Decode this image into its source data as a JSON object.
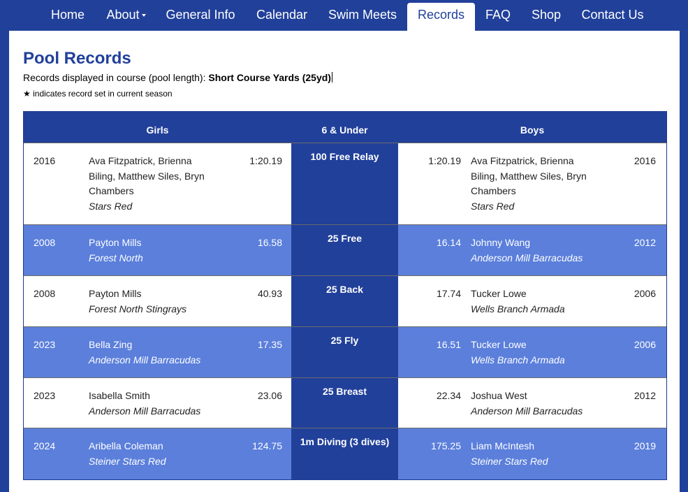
{
  "nav": {
    "items": [
      {
        "label": "Home"
      },
      {
        "label": "About"
      },
      {
        "label": "General Info"
      },
      {
        "label": "Calendar"
      },
      {
        "label": "Swim Meets"
      },
      {
        "label": "Records"
      },
      {
        "label": "FAQ"
      },
      {
        "label": "Shop"
      },
      {
        "label": "Contact Us"
      }
    ],
    "active": "Records"
  },
  "page": {
    "title": "Pool Records",
    "course_prefix": "Records displayed in course (pool length):",
    "course_value": "Short Course Yards (25yd)",
    "star_symbol": "★",
    "star_note": "indicates record set in current season"
  },
  "table": {
    "headers": {
      "girls": "Girls",
      "age_group": "6 & Under",
      "boys": "Boys"
    },
    "rows": [
      {
        "event": "100 Free Relay",
        "girls": {
          "year": "2016",
          "name": "Ava Fitzpatrick, Brienna Biling, Matthew Siles, Bryn Chambers",
          "team": "Stars Red",
          "time": "1:20.19"
        },
        "boys": {
          "year": "2016",
          "name": "Ava Fitzpatrick, Brienna Biling, Matthew Siles, Bryn Chambers",
          "team": "Stars Red",
          "time": "1:20.19"
        }
      },
      {
        "event": "25 Free",
        "girls": {
          "year": "2008",
          "name": "Payton Mills",
          "team": "Forest North",
          "time": "16.58"
        },
        "boys": {
          "year": "2012",
          "name": "Johnny Wang",
          "team": "Anderson Mill Barracudas",
          "time": "16.14"
        }
      },
      {
        "event": "25 Back",
        "girls": {
          "year": "2008",
          "name": "Payton Mills",
          "team": "Forest North Stingrays",
          "time": "40.93"
        },
        "boys": {
          "year": "2006",
          "name": "Tucker Lowe",
          "team": "Wells Branch Armada",
          "time": "17.74"
        }
      },
      {
        "event": "25 Fly",
        "girls": {
          "year": "2023",
          "name": "Bella Zing",
          "team": "Anderson Mill Barracudas",
          "time": "17.35"
        },
        "boys": {
          "year": "2006",
          "name": "Tucker Lowe",
          "team": "Wells Branch Armada",
          "time": "16.51"
        }
      },
      {
        "event": "25 Breast",
        "girls": {
          "year": "2023",
          "name": "Isabella Smith",
          "team": "Anderson Mill Barracudas",
          "time": "23.06"
        },
        "boys": {
          "year": "2012",
          "name": "Joshua West",
          "team": "Anderson Mill Barracudas",
          "time": "22.34"
        }
      },
      {
        "event": "1m Diving (3 dives)",
        "girls": {
          "year": "2024",
          "name": "Aribella Coleman",
          "team": "Steiner Stars Red",
          "time": "124.75"
        },
        "boys": {
          "year": "2019",
          "name": "Liam McIntesh",
          "team": "Steiner Stars Red",
          "time": "175.25"
        }
      }
    ]
  },
  "colors": {
    "brand_blue": "#21409a",
    "row_blue": "#5b7fdb",
    "white": "#ffffff"
  }
}
